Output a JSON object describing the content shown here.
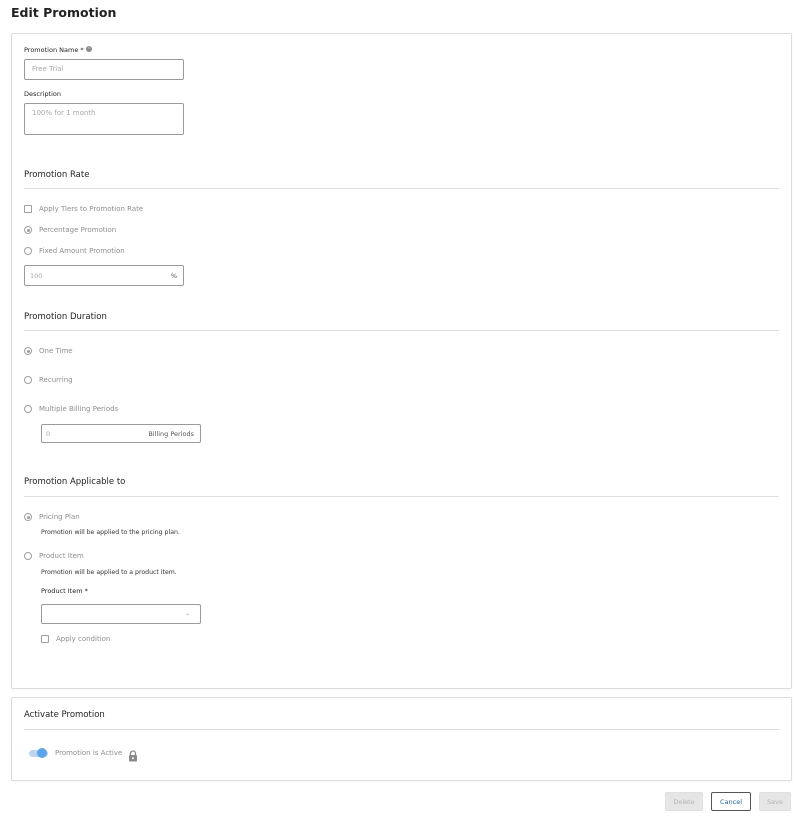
{
  "page": {
    "title": "Edit Promotion"
  },
  "details": {
    "name_label": "Promotion Name *",
    "name_value": "Free Trial",
    "description_label": "Description",
    "description_value": "100% for 1 month"
  },
  "rate": {
    "title": "Promotion Rate",
    "apply_tiers_label": "Apply Tiers to Promotion Rate",
    "apply_tiers_checked": false,
    "options": [
      "Percentage Promotion",
      "Fixed Amount Promotion"
    ],
    "selected": "Percentage Promotion",
    "value": "100",
    "unit": "%"
  },
  "duration": {
    "title": "Promotion Duration",
    "options": [
      "One Time",
      "Recurring",
      "Multiple Billing Periods"
    ],
    "selected": "One Time",
    "billing_periods_value": "0",
    "billing_periods_unit": "Billing Periods"
  },
  "applicable": {
    "title": "Promotion Applicable to",
    "pricing_plan_label": "Pricing Plan",
    "pricing_plan_help": "Promotion will be applied to the pricing plan.",
    "product_item_label": "Product Item",
    "product_item_help": "Promotion will be applied to a product item.",
    "selected": "Pricing Plan",
    "product_item_field_label": "Product Item *",
    "product_item_value": "",
    "apply_condition_label": "Apply condition",
    "apply_condition_checked": false
  },
  "activate": {
    "title": "Activate Promotion",
    "active_label": "Promotion is Active",
    "active": true
  },
  "actions": {
    "delete_label": "Delete",
    "cancel_label": "Cancel",
    "save_label": "Save"
  },
  "icons": {
    "info": "info-icon",
    "lock": "lock-icon",
    "dropdown": "chevron-down-icon"
  }
}
